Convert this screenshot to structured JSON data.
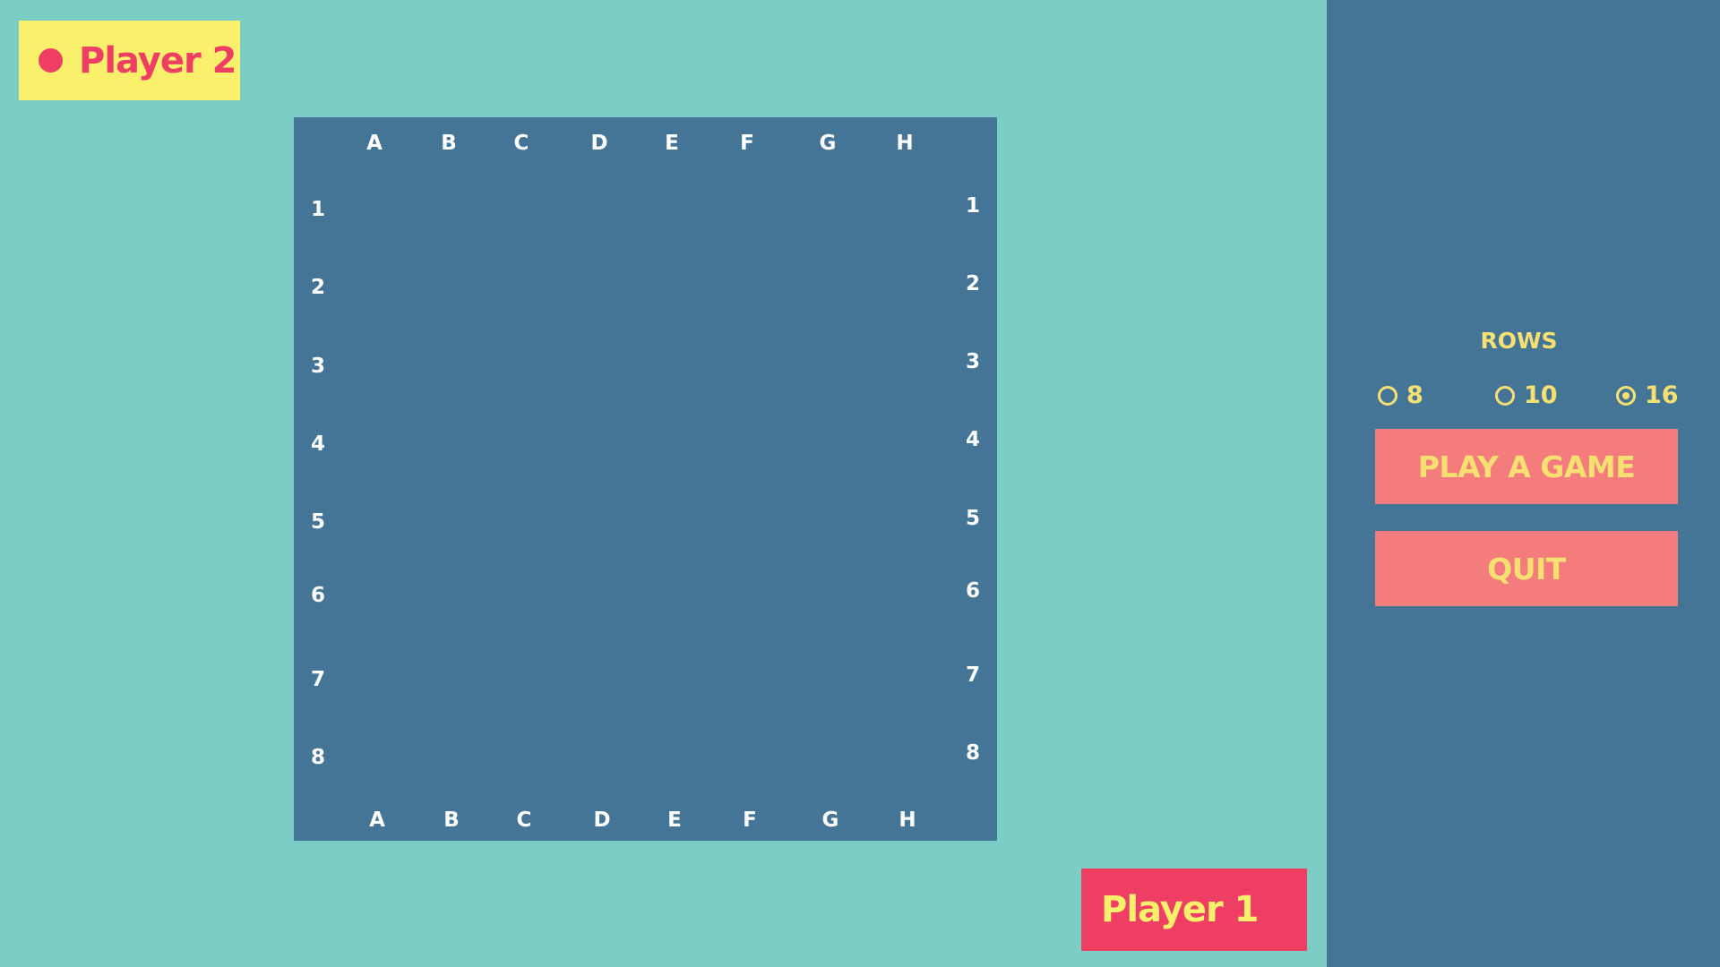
{
  "players": {
    "top_label": "Player 2",
    "bottom_label": "Player 1"
  },
  "board": {
    "columns": [
      "A",
      "B",
      "C",
      "D",
      "E",
      "F",
      "G",
      "H"
    ],
    "rows": [
      "1",
      "2",
      "3",
      "4",
      "5",
      "6",
      "7",
      "8"
    ]
  },
  "sidebar": {
    "rows_title": "ROWS",
    "row_options": [
      {
        "label": "8",
        "checked": false
      },
      {
        "label": "10",
        "checked": false
      },
      {
        "label": "16",
        "checked": true
      }
    ],
    "play_label": "PLAY A GAME",
    "quit_label": "QUIT"
  },
  "colors": {
    "background": "#7bcdc6",
    "board": "#447596",
    "sidebar": "#447596",
    "accent_yellow": "#fbf06b",
    "accent_red": "#ef3e64",
    "button": "#f47c7c",
    "sidebar_text": "#f6e072"
  },
  "icons": {
    "turn_indicator": "circle-dot-icon",
    "radio": "radio-circle-icon"
  }
}
